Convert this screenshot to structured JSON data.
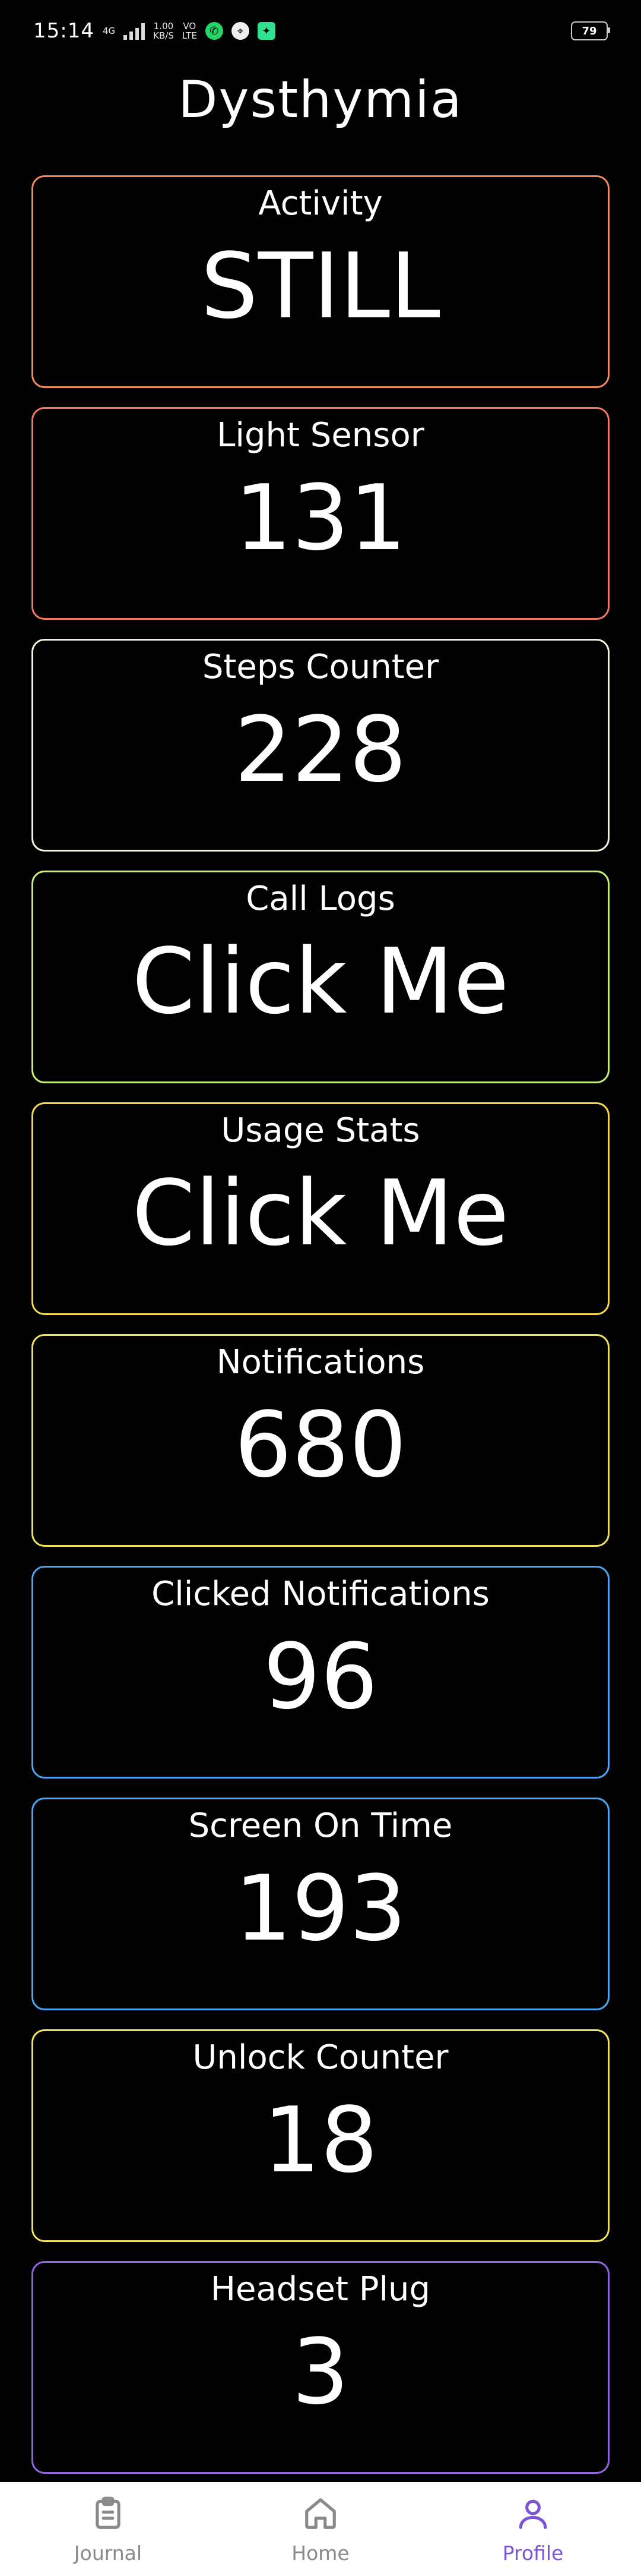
{
  "status_bar": {
    "time": "15:14",
    "network_top": "1.00",
    "network_bottom": "KB/S",
    "lte_top": "VO",
    "lte_bottom": "LTE",
    "signal_label": "4G",
    "battery": "79",
    "icons": [
      "whatsapp-icon",
      "location-icon",
      "app-icon"
    ]
  },
  "app": {
    "title": "Dysthymia"
  },
  "cards": [
    {
      "label": "Activity",
      "value": "STILL",
      "color": "#f08a5b"
    },
    {
      "label": "Light Sensor",
      "value": "131",
      "color": "#f07860"
    },
    {
      "label": "Steps Counter",
      "value": "228",
      "color": "#f3f1dc"
    },
    {
      "label": "Call Logs",
      "value": "Click Me",
      "color": "#c6f070"
    },
    {
      "label": "Usage Stats",
      "value": "Click Me",
      "color": "#f6d94a"
    },
    {
      "label": "Notifications",
      "value": "680",
      "color": "#f3df5a"
    },
    {
      "label": "Clicked Notifications",
      "value": "96",
      "color": "#4ea4f0"
    },
    {
      "label": "Screen On Time",
      "value": "193",
      "color": "#48a6f2"
    },
    {
      "label": "Unlock Counter",
      "value": "18",
      "color": "#f3e35a"
    },
    {
      "label": "Headset Plug",
      "value": "3",
      "color": "#9166e0"
    }
  ],
  "nav": {
    "items": [
      {
        "label": "Journal",
        "icon": "clipboard-icon",
        "active": false
      },
      {
        "label": "Home",
        "icon": "home-icon",
        "active": false
      },
      {
        "label": "Profile",
        "icon": "profile-icon",
        "active": true
      }
    ],
    "active_color": "#7b55d6",
    "inactive_color": "#8a8a8a"
  }
}
